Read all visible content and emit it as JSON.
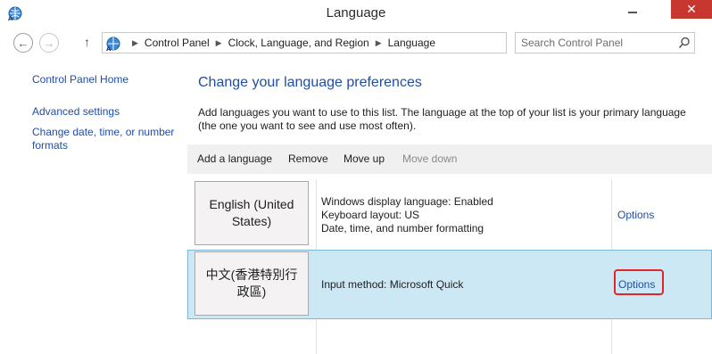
{
  "window": {
    "title": "Language",
    "close_glyph": "✕"
  },
  "nav": {
    "back_glyph": "←",
    "forward_glyph": "→",
    "up_glyph": "↑",
    "breadcrumbs": [
      "Control Panel",
      "Clock, Language, and Region",
      "Language"
    ],
    "search_placeholder": "Search Control Panel"
  },
  "sidebar": {
    "items": [
      {
        "label": "Control Panel Home"
      },
      {
        "label": "Advanced settings"
      },
      {
        "label": "Change date, time, or number formats"
      }
    ]
  },
  "main": {
    "title": "Change your language preferences",
    "description": "Add languages you want to use to this list. The language at the top of your list is your primary language (the one you want to see and use most often)."
  },
  "toolbar": {
    "add_label": "Add a language",
    "remove_label": "Remove",
    "move_up_label": "Move up",
    "move_down_label": "Move down"
  },
  "languages": [
    {
      "name": "English (United States)",
      "details": [
        "Windows display language: Enabled",
        "Keyboard layout: US",
        "Date, time, and number formatting"
      ],
      "options_label": "Options",
      "selected": false
    },
    {
      "name": "中文(香港特別行政區)",
      "details": [
        "Input method: Microsoft Quick"
      ],
      "options_label": "Options",
      "selected": true
    }
  ],
  "colors": {
    "link": "#1e4ea8",
    "selection": "#cce8f4",
    "close": "#c7372f",
    "annotation": "#e0262a"
  }
}
